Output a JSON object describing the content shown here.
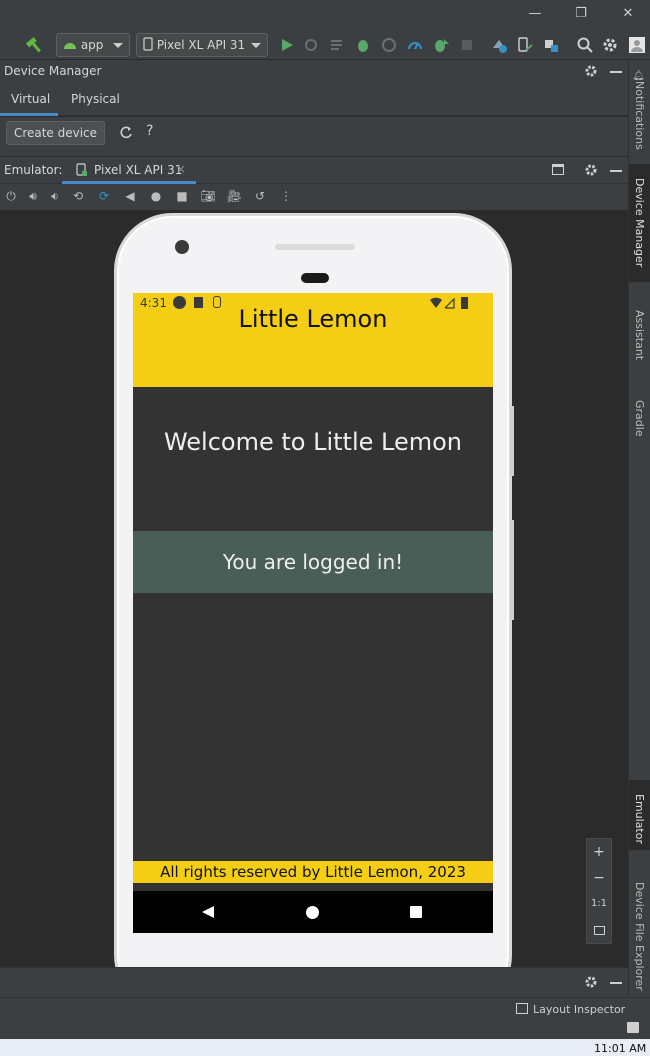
{
  "toolbar": {
    "config": "app",
    "device": "Pixel XL API 31"
  },
  "device_manager": {
    "title": "Device Manager",
    "tabs": [
      "Virtual",
      "Physical"
    ],
    "create_button": "Create device",
    "help": "?"
  },
  "emulator": {
    "label": "Emulator:",
    "tab": "Pixel XL API 31",
    "close": "×"
  },
  "phone": {
    "time": "4:31",
    "app_title": "Little Lemon",
    "welcome": "Welcome to Little Lemon",
    "logged_in": "You are logged in!",
    "footer": "All rights reserved by Little Lemon, 2023"
  },
  "zoom": {
    "plus": "+",
    "minus": "−",
    "ratio": "1:1"
  },
  "right_tabs": [
    "Notifications",
    "Device Manager",
    "Assistant",
    "Gradle",
    "Emulator",
    "Device File Explorer"
  ],
  "status": {
    "layout_inspector": "Layout Inspector",
    "clock": "11:01 AM"
  },
  "colors": {
    "lemon": "#F4CE14",
    "green": "#495E57",
    "dark": "#333333"
  }
}
